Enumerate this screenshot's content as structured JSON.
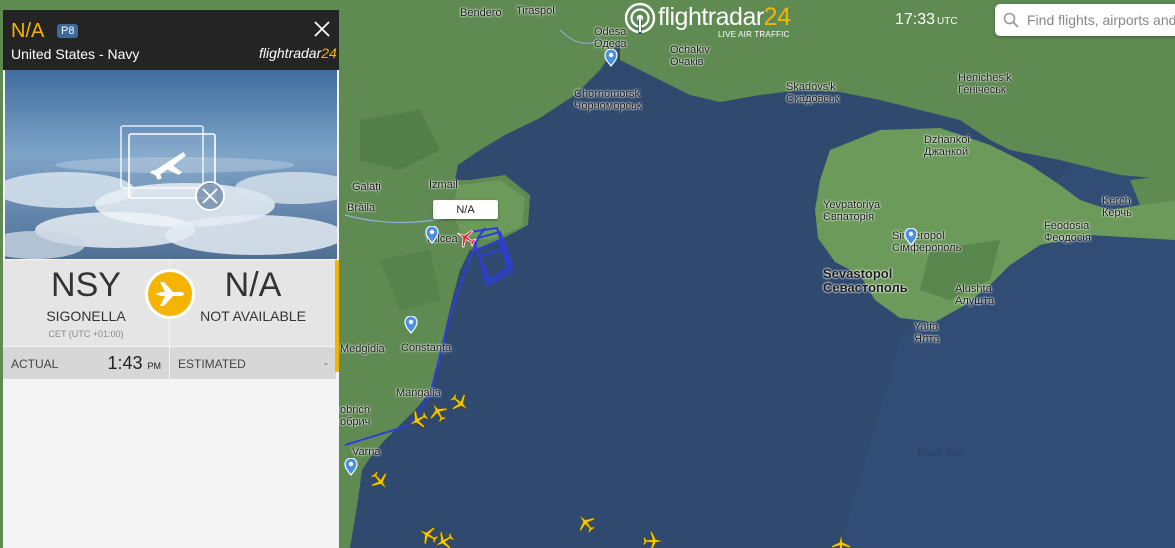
{
  "topbar": {
    "brand_main": "flightradar",
    "brand_num": "24",
    "brand_sub": "LIVE AIR TRAFFIC",
    "time": "17:33",
    "time_zone": "UTC",
    "search_placeholder": "Find flights, airports and more"
  },
  "panel": {
    "callsign": "N/A",
    "aircraft_type": "P8",
    "airline": "United States - Navy",
    "brand_main": "flightradar",
    "brand_num": "24",
    "origin": {
      "code": "NSY",
      "name": "SIGONELLA",
      "timezone": "CET (UTC +01:00)",
      "time_label": "ACTUAL",
      "time": "1:43",
      "time_suffix": "PM"
    },
    "destination": {
      "code": "N/A",
      "name": "NOT AVAILABLE",
      "time_label": "ESTIMATED",
      "time": "-"
    }
  },
  "map": {
    "selected_aircraft_label": "N/A",
    "labels": [
      {
        "id": "bendero",
        "text": "Bendero"
      },
      {
        "id": "tiraspol",
        "text": "Tiraspol"
      },
      {
        "id": "odesa",
        "text": "Odesa\nОдеса"
      },
      {
        "id": "ochakiv",
        "text": "Ochakiv\nОчаків"
      },
      {
        "id": "chornomorsk",
        "text": "Chornomorsk\nЧорноморськ"
      },
      {
        "id": "skadovsk",
        "text": "Skadovs'k\nСкадовськ"
      },
      {
        "id": "henichesk",
        "text": "Heniches'k\nГенічеськ"
      },
      {
        "id": "dzhankoi",
        "text": "Dzhankoi\nДжанкой"
      },
      {
        "id": "galati",
        "text": "Galați"
      },
      {
        "id": "izmail",
        "text": "Izmail"
      },
      {
        "id": "braila",
        "text": "Brăila"
      },
      {
        "id": "tulcea",
        "text": "Tulcea"
      },
      {
        "id": "yevpatoriya",
        "text": "Yevpatoriya\nЄвпаторія"
      },
      {
        "id": "simferopol",
        "text": "Simferopol\nСімферополь"
      },
      {
        "id": "kerch",
        "text": "Kerch\nКерчь"
      },
      {
        "id": "feodosia",
        "text": "Feodosia\nФеодосія"
      },
      {
        "id": "sevastopol",
        "text": "Sevastopol\nСевастополь"
      },
      {
        "id": "alushta",
        "text": "Alushta\nАлушта"
      },
      {
        "id": "yalta",
        "text": "Yalta\nЯлта"
      },
      {
        "id": "medgidia",
        "text": "Medgidia"
      },
      {
        "id": "constanta",
        "text": "Constanța"
      },
      {
        "id": "mangalia",
        "text": "Mangalia"
      },
      {
        "id": "dobrich",
        "text": "obrich\nобрич"
      },
      {
        "id": "varna",
        "text": "Varna"
      },
      {
        "id": "blacksea",
        "text": "Black Sea"
      }
    ]
  },
  "colors": {
    "sea": "#2f4a6e",
    "land": "#5f8a52",
    "accent": "#f5b400",
    "track": "#2d3fd6",
    "selected_plane": "#e8243c"
  }
}
